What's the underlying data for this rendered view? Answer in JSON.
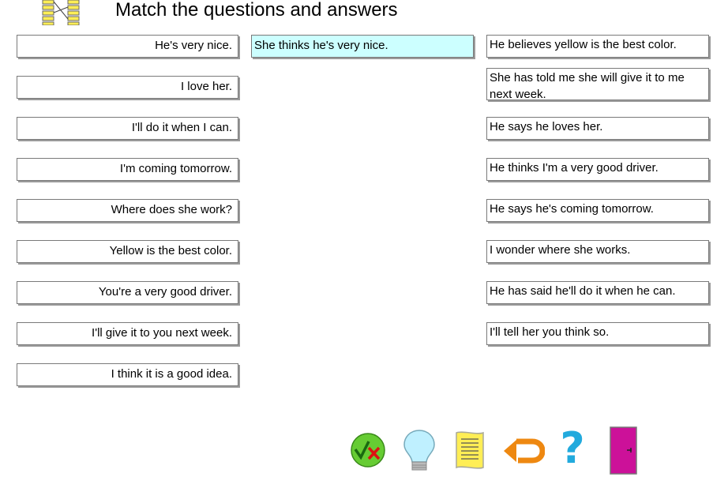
{
  "header": {
    "title": "Match the questions and answers",
    "logo_icon": "matching-icon"
  },
  "questions": [
    "He's very nice.",
    "I love her.",
    "I'll do it when I can.",
    "I'm coming tomorrow.",
    "Where does she work?",
    "Yellow is the best color.",
    "You're a very good driver.",
    "I'll give it to you next week.",
    "I think it is a good idea."
  ],
  "placed_answer": "She thinks he's very nice.",
  "answers": [
    "He believes yellow is the best color.",
    "She has told me she will give it to me next week.",
    "He says he loves her.",
    "He thinks I'm a very good driver.",
    "He says he's coming tomorrow.",
    "I wonder where she works.",
    "He has said he'll do it when he can.",
    "I'll tell her you think so."
  ],
  "toolbar": {
    "check_icon": "check-answers-icon",
    "hint_icon": "lightbulb-hint-icon",
    "notes_icon": "notes-page-icon",
    "restart_icon": "restart-arrow-icon",
    "help_icon": "help-question-icon",
    "exit_icon": "exit-door-icon"
  },
  "colors": {
    "placed_bg": "#ccffff",
    "check_circle": "#66cc33",
    "help": "#22aadd",
    "exit_door": "#cc1199",
    "restart": "#ee8811",
    "notes": "#ffee55"
  }
}
